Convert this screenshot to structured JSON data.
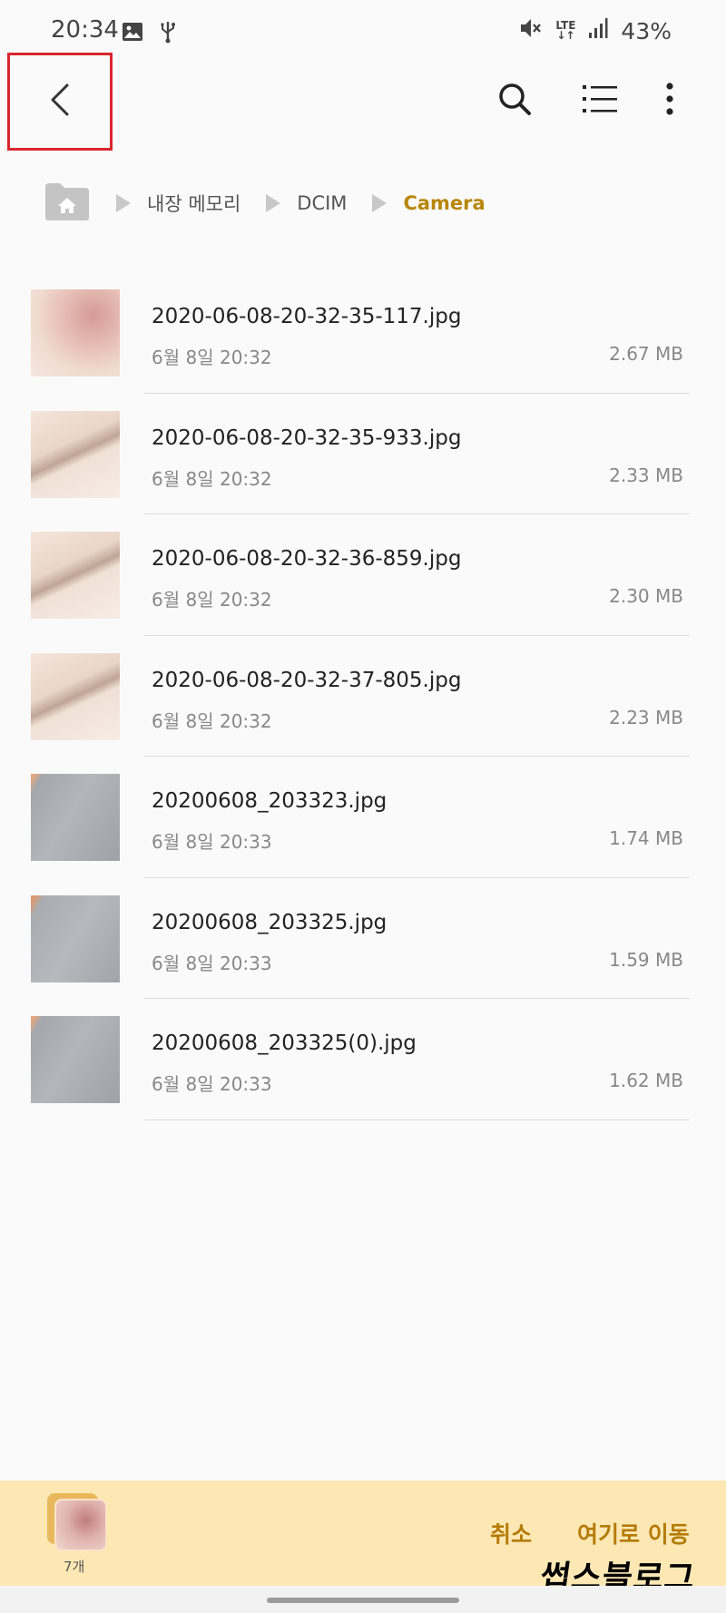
{
  "status_bar": {
    "time": "20:34",
    "battery": "43%",
    "network": "LTE",
    "icons": [
      "image-icon",
      "usb-icon",
      "mute-icon",
      "lte-icon",
      "signal-icon"
    ]
  },
  "toolbar": {
    "back_icon": "chevron-left-icon",
    "search_icon": "search-icon",
    "view_icon": "list-view-icon",
    "more_icon": "more-vert-icon"
  },
  "breadcrumb": {
    "home_icon": "home-folder-icon",
    "items": [
      "내장 메모리",
      "DCIM",
      "Camera"
    ]
  },
  "files": [
    {
      "name": "2020-06-08-20-32-35-117.jpg",
      "date": "6월 8일 20:32",
      "size": "2.67 MB"
    },
    {
      "name": "2020-06-08-20-32-35-933.jpg",
      "date": "6월 8일 20:32",
      "size": "2.33 MB"
    },
    {
      "name": "2020-06-08-20-32-36-859.jpg",
      "date": "6월 8일 20:32",
      "size": "2.30 MB"
    },
    {
      "name": "2020-06-08-20-32-37-805.jpg",
      "date": "6월 8일 20:32",
      "size": "2.23 MB"
    },
    {
      "name": "20200608_203323.jpg",
      "date": "6월 8일 20:33",
      "size": "1.74 MB"
    },
    {
      "name": "20200608_203325.jpg",
      "date": "6월 8일 20:33",
      "size": "1.59 MB"
    },
    {
      "name": "20200608_203325(0).jpg",
      "date": "6월 8일 20:33",
      "size": "1.62 MB"
    }
  ],
  "bottom_bar": {
    "selected_count": "7개",
    "cancel_label": "취소",
    "move_here_label": "여기로 이동"
  },
  "watermark": "썹스블로그",
  "colors": {
    "accent": "#b8860b",
    "action_text": "#b47b08",
    "bottom_bar_bg": "#fde8b4",
    "highlight_border": "#d9262e"
  }
}
